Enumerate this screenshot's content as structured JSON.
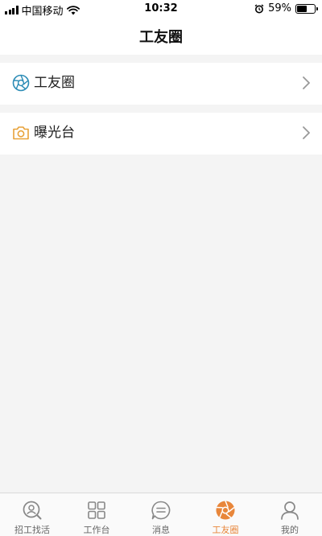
{
  "status_bar": {
    "carrier": "中国移动",
    "time": "10:32",
    "battery_percent": "59%",
    "battery_level": 0.59,
    "icons": [
      "signal-icon",
      "wifi-icon",
      "alarm-icon",
      "battery-icon"
    ]
  },
  "header": {
    "title": "工友圈"
  },
  "list": {
    "items": [
      {
        "label": "工友圈",
        "icon": "aperture-icon",
        "icon_color": "#2a8bb5"
      },
      {
        "label": "曝光台",
        "icon": "camera-icon",
        "icon_color": "#e8a23a"
      }
    ]
  },
  "tab_bar": {
    "active_color": "#e8863a",
    "inactive_color": "#888888",
    "tabs": [
      {
        "label": "招工找活",
        "icon": "search-person-icon",
        "active": false
      },
      {
        "label": "工作台",
        "icon": "grid-icon",
        "active": false
      },
      {
        "label": "消息",
        "icon": "chat-icon",
        "active": false
      },
      {
        "label": "工友圈",
        "icon": "aperture-icon",
        "active": true
      },
      {
        "label": "我的",
        "icon": "person-icon",
        "active": false
      }
    ]
  }
}
